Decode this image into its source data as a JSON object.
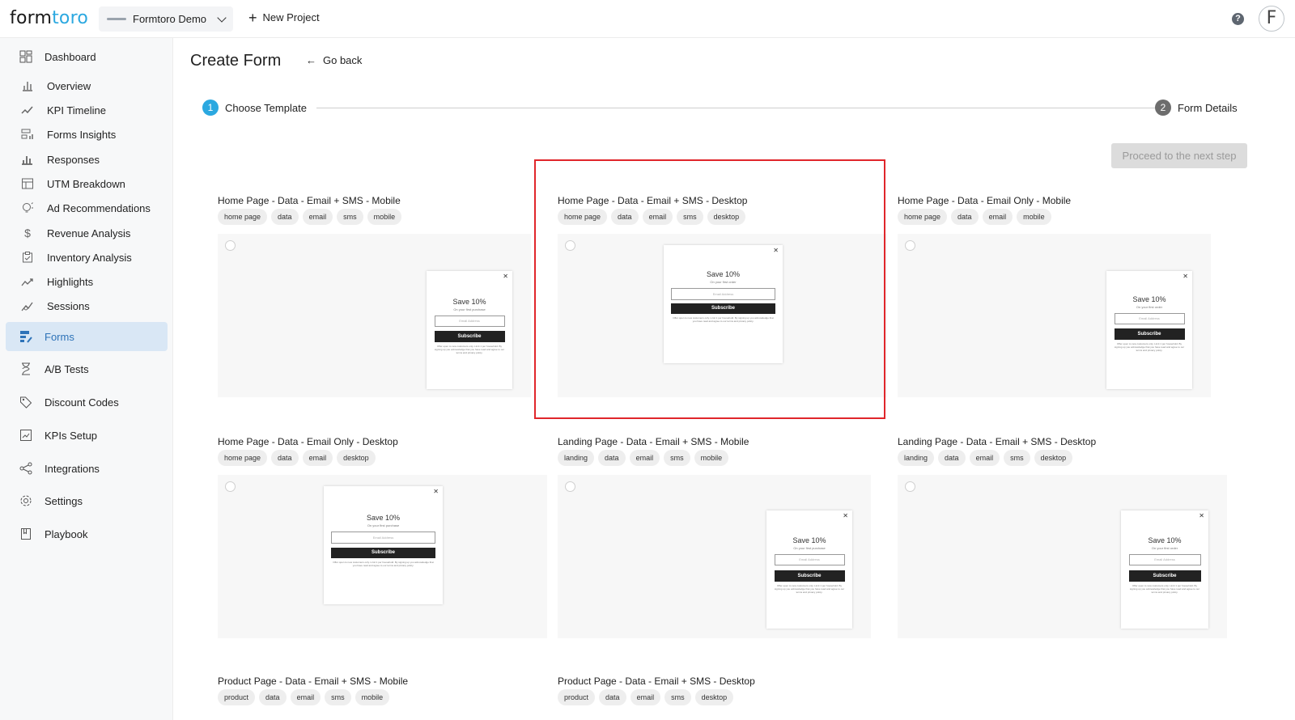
{
  "brand": {
    "logo_text_a": "form",
    "logo_text_b": "toro"
  },
  "header": {
    "project_name": "Formtoro Demo",
    "new_project_label": "New Project",
    "help_icon": "?",
    "avatar_letter": "F"
  },
  "sidebar": {
    "items": [
      {
        "label": "Dashboard",
        "icon": "dashboard-icon"
      },
      {
        "label": "Overview",
        "icon": "bar-chart-icon"
      },
      {
        "label": "KPI Timeline",
        "icon": "trend-line-icon"
      },
      {
        "label": "Forms Insights",
        "icon": "forms-insights-icon"
      },
      {
        "label": "Responses",
        "icon": "responses-icon"
      },
      {
        "label": "UTM Breakdown",
        "icon": "table-icon"
      },
      {
        "label": "Ad Recommendations",
        "icon": "lightbulb-icon"
      },
      {
        "label": "Revenue Analysis",
        "icon": "dollar-icon"
      },
      {
        "label": "Inventory Analysis",
        "icon": "clipboard-icon"
      },
      {
        "label": "Highlights",
        "icon": "highlights-icon"
      },
      {
        "label": "Sessions",
        "icon": "sessions-icon"
      },
      {
        "label": "Forms",
        "icon": "forms-icon"
      },
      {
        "label": "A/B Tests",
        "icon": "hourglass-icon"
      },
      {
        "label": "Discount Codes",
        "icon": "tag-icon"
      },
      {
        "label": "KPIs Setup",
        "icon": "kpi-setup-icon"
      },
      {
        "label": "Integrations",
        "icon": "share-icon"
      },
      {
        "label": "Settings",
        "icon": "gear-icon"
      },
      {
        "label": "Playbook",
        "icon": "book-icon"
      }
    ],
    "active_item": "Forms",
    "active_color": "#2e73b8",
    "active_bg": "#d9e7f5"
  },
  "page": {
    "title": "Create Form",
    "back_label": "Go back",
    "steps": [
      {
        "num": "1",
        "label": "Choose Template"
      },
      {
        "num": "2",
        "label": "Form Details"
      }
    ],
    "proceed_label": "Proceed to the next step"
  },
  "popup_text": {
    "title": "Save 10%",
    "subtitle": "On your first purchase",
    "subtitle_alt": "On your first order",
    "input_placeholder": "Email Address",
    "button": "Subscribe",
    "fine_print": "Offer open to new customers only. Limit 1 per household. By signing up you acknowledge that you have read and agree to our terms and privacy policy."
  },
  "templates": [
    {
      "title": "Home Page - Data - Email + SMS - Mobile",
      "tags": [
        "home page",
        "data",
        "email",
        "sms",
        "mobile"
      ]
    },
    {
      "title": "Home Page - Data - Email + SMS - Desktop",
      "tags": [
        "home page",
        "data",
        "email",
        "sms",
        "desktop"
      ]
    },
    {
      "title": "Home Page - Data - Email Only - Mobile",
      "tags": [
        "home page",
        "data",
        "email",
        "mobile"
      ]
    },
    {
      "title": "Home Page - Data - Email Only - Desktop",
      "tags": [
        "home page",
        "data",
        "email",
        "desktop"
      ]
    },
    {
      "title": "Landing Page - Data - Email + SMS - Mobile",
      "tags": [
        "landing",
        "data",
        "email",
        "sms",
        "mobile"
      ]
    },
    {
      "title": "Landing Page - Data - Email + SMS - Desktop",
      "tags": [
        "landing",
        "data",
        "email",
        "sms",
        "desktop"
      ]
    },
    {
      "title": "Product Page - Data - Email + SMS - Mobile",
      "tags": [
        "product",
        "data",
        "email",
        "sms",
        "mobile"
      ]
    },
    {
      "title": "Product Page - Data - Email + SMS - Desktop",
      "tags": [
        "product",
        "data",
        "email",
        "sms",
        "desktop"
      ]
    }
  ],
  "colors": {
    "accent": "#2ba8e0",
    "highlight_border": "#e0262b"
  }
}
